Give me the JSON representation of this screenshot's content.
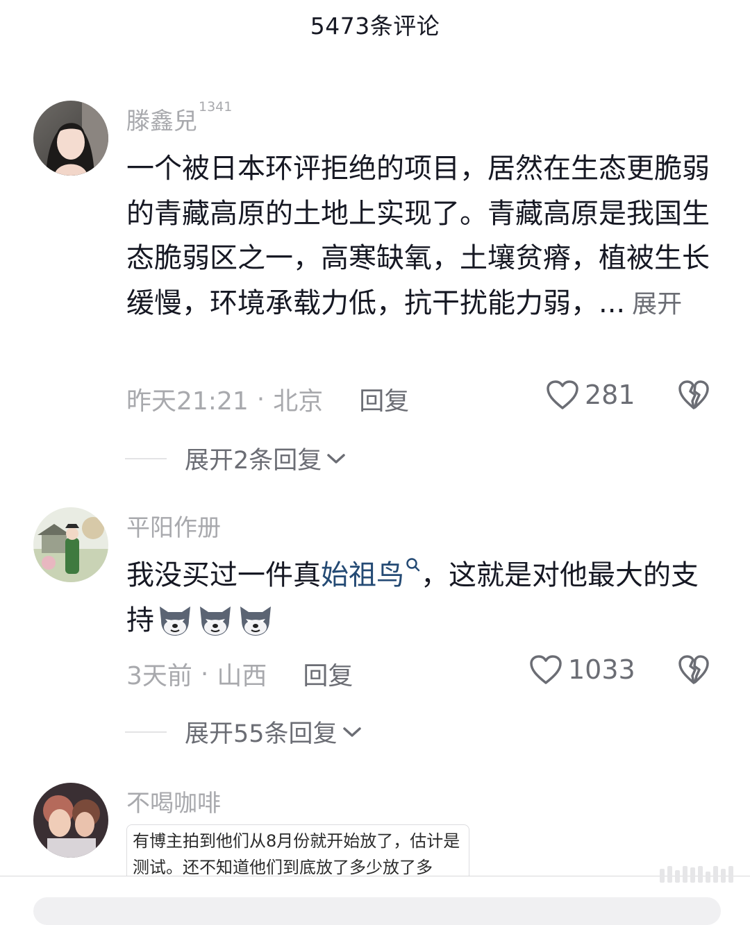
{
  "header": {
    "title": "5473条评论"
  },
  "comments": [
    {
      "username": "滕鑫兒",
      "username_badge": "1341",
      "text": "一个被日本环评拒绝的项目，居然在生态更脆弱的青藏高原的土地上实现了。青藏高原是我国生态脆弱区之一，高寒缺氧，土壤贫瘠，植被生长缓慢，环境承载力低，抗干扰能力弱，...",
      "expand_label": "展开",
      "time": "昨天21:21",
      "location": "北京",
      "reply_label": "回复",
      "likes": "281",
      "replies_toggle": "展开2条回复"
    },
    {
      "username": "平阳作册",
      "text_before": "我没买过一件真",
      "topic_link": "始祖鸟",
      "text_after": "，这就是对他最大的支持",
      "time": "3天前",
      "location": "山西",
      "reply_label": "回复",
      "likes": "1033",
      "replies_toggle": "展开55条回复"
    },
    {
      "username": "不喝咖啡",
      "quote_text": "有博主拍到他们从8月份就开始放了，估计是测试。还不知道他们到底放了多少放了多"
    }
  ],
  "icons": {
    "like": "heart-outline-icon",
    "dislike": "broken-heart-icon",
    "chevron": "chevron-down-icon",
    "search": "search-icon",
    "emoji": "wolf-emoji-icon"
  },
  "colors": {
    "primary_text": "#161823",
    "secondary_text": "#a8a9ad",
    "action_text": "#6b6d74",
    "link": "#244a74"
  }
}
